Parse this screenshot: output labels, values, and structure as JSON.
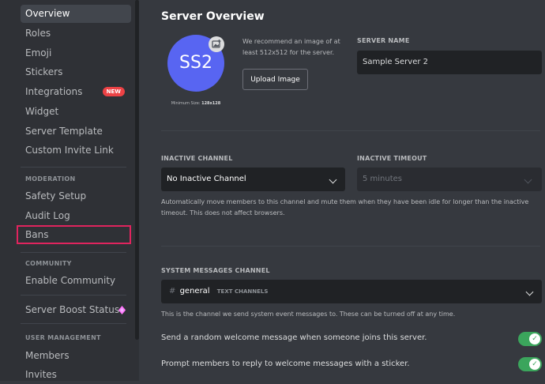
{
  "sidebar": {
    "items": [
      {
        "label": "Overview"
      },
      {
        "label": "Roles"
      },
      {
        "label": "Emoji"
      },
      {
        "label": "Stickers"
      },
      {
        "label": "Integrations",
        "badge": "NEW"
      },
      {
        "label": "Widget"
      },
      {
        "label": "Server Template"
      },
      {
        "label": "Custom Invite Link"
      }
    ],
    "moderation_header": "MODERATION",
    "moderation_items": [
      {
        "label": "Safety Setup"
      },
      {
        "label": "Audit Log"
      },
      {
        "label": "Bans"
      }
    ],
    "community_header": "COMMUNITY",
    "community_items": [
      {
        "label": "Enable Community"
      }
    ],
    "boost_item": {
      "label": "Server Boost Status"
    },
    "user_management_header": "USER MANAGEMENT",
    "user_management_items": [
      {
        "label": "Members"
      },
      {
        "label": "Invites"
      }
    ]
  },
  "main": {
    "title": "Server Overview",
    "avatar_initials": "SS2",
    "min_size_label": "Minimum Size:",
    "min_size_value": "128x128",
    "recommendation": "We recommend an image of at least 512x512 for the server.",
    "upload_button": "Upload Image",
    "server_name_label": "SERVER NAME",
    "server_name_value": "Sample Server 2",
    "inactive_channel_label": "INACTIVE CHANNEL",
    "inactive_channel_value": "No Inactive Channel",
    "inactive_timeout_label": "INACTIVE TIMEOUT",
    "inactive_timeout_value": "5 minutes",
    "inactive_help": "Automatically move members to this channel and mute them when they have been idle for longer than the inactive timeout. This does not affect browsers.",
    "system_channel_label": "SYSTEM MESSAGES CHANNEL",
    "system_channel_hash": "#",
    "system_channel_value": "general",
    "system_channel_category": "TEXT CHANNELS",
    "system_help": "This is the channel we send system event messages to. These can be turned off at any time.",
    "toggles": [
      {
        "label": "Send a random welcome message when someone joins this server.",
        "on": true
      },
      {
        "label": "Prompt members to reply to welcome messages with a sticker.",
        "on": true
      }
    ]
  },
  "colors": {
    "accent": "#5865f2",
    "toggle_on": "#3ba55c",
    "new_badge": "#ed4245",
    "highlight": "#e0245e"
  }
}
